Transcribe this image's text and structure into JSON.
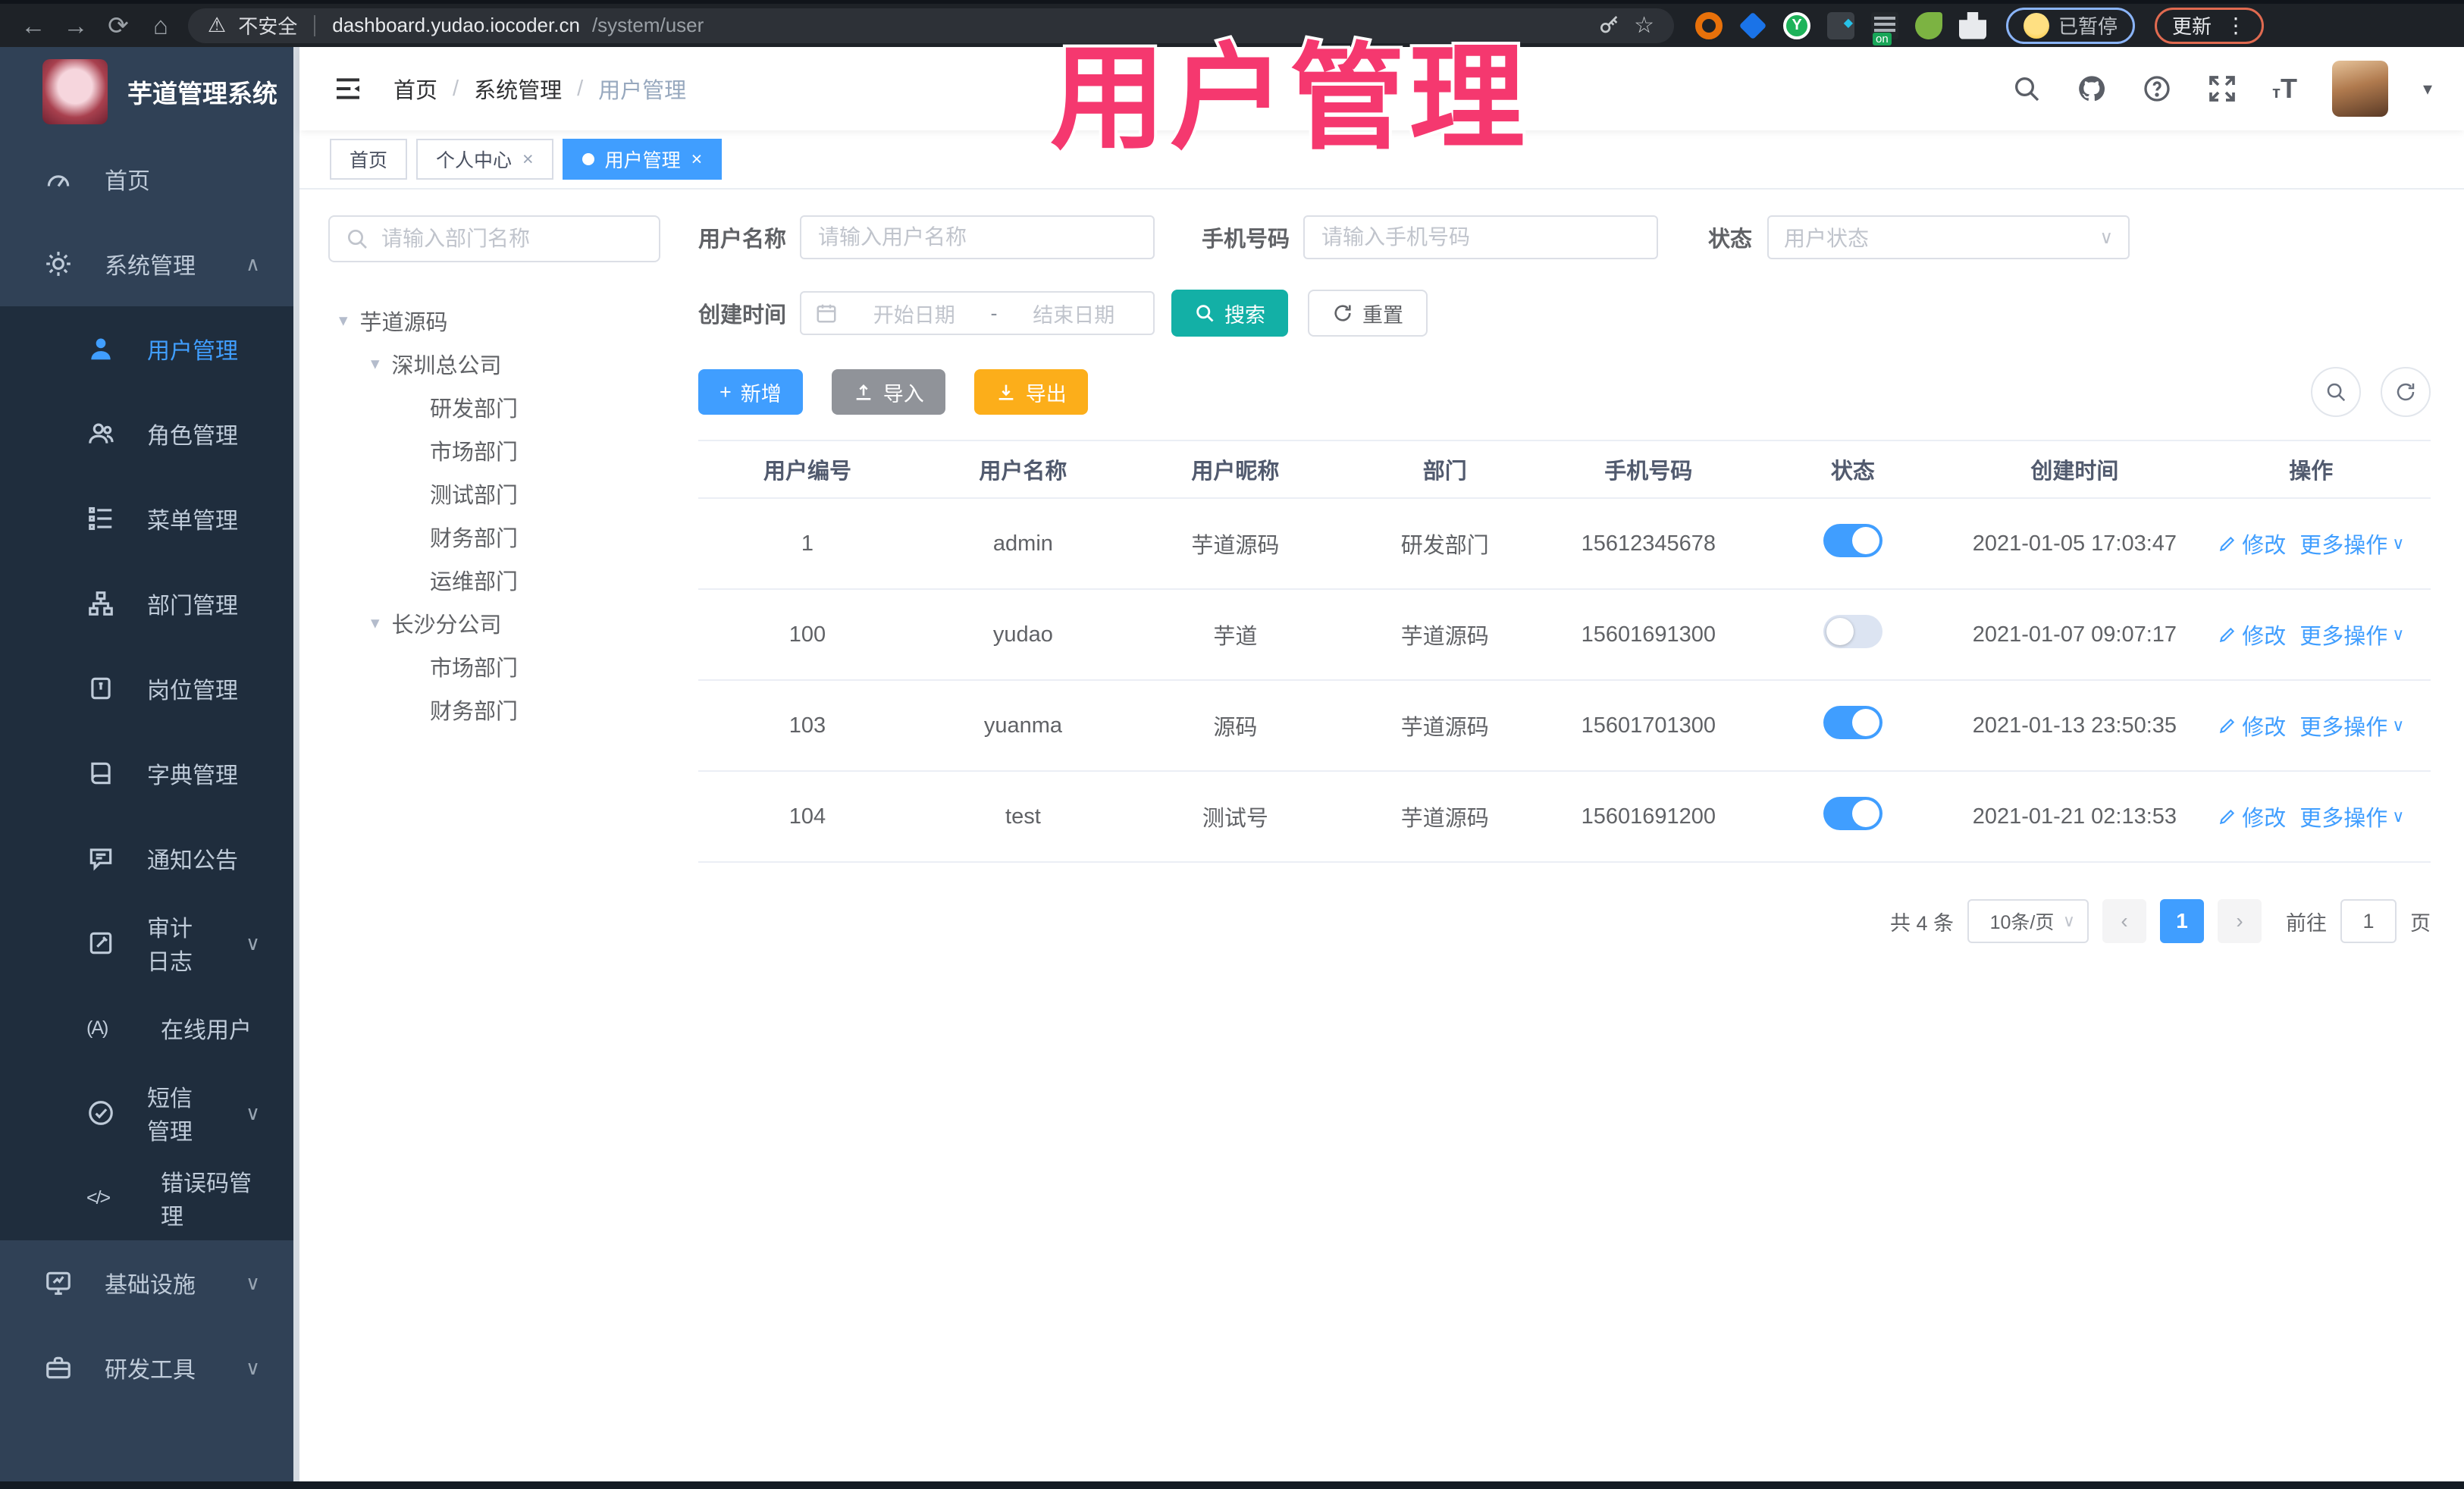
{
  "colors": {
    "accent_blue": "#409eff",
    "search_teal": "#13b0a6",
    "export_amber": "#fcae1a",
    "import_gray": "#909399",
    "sidebar_bg": "#304156",
    "submenu_bg": "#1f2d3d",
    "overlay_pink": "#f5386f",
    "toggle_off": "#dce4f2"
  },
  "browser": {
    "security_label": "不安全",
    "url_host": "dashboard.yudao.iocoder.cn",
    "url_path": "/system/user",
    "paused_label": "已暂停",
    "update_label": "更新",
    "nav_icons": [
      "back-icon",
      "forward-icon",
      "reload-icon",
      "home-icon"
    ],
    "pill_icons": [
      "warning-icon",
      "key-icon",
      "star-icon"
    ],
    "glyphs": {
      "back": "←",
      "forward": "→",
      "reload": "⟳",
      "home": "⌂",
      "warning": "⚠",
      "star": "☆",
      "kebab": "⋮",
      "green_ext": "Y"
    }
  },
  "overlay_title": "用户管理",
  "sidebar": {
    "logo_title": "芋道管理系统",
    "items": [
      {
        "label": "首页",
        "icon": "gauge-icon"
      },
      {
        "label": "系统管理",
        "icon": "gear-icon",
        "chevron": "∧"
      },
      {
        "label": "用户管理",
        "icon": "user-icon",
        "active": true
      },
      {
        "label": "角色管理",
        "icon": "roles-icon"
      },
      {
        "label": "菜单管理",
        "icon": "menu-list-icon"
      },
      {
        "label": "部门管理",
        "icon": "org-tree-icon"
      },
      {
        "label": "岗位管理",
        "icon": "post-badge-icon"
      },
      {
        "label": "字典管理",
        "icon": "dictionary-icon"
      },
      {
        "label": "通知公告",
        "icon": "announcement-icon"
      },
      {
        "label": "审计日志",
        "icon": "audit-log-icon",
        "chevron": "∨"
      },
      {
        "label": "在线用户",
        "icon": "online-user-icon",
        "icon_text": "(A)"
      },
      {
        "label": "短信管理",
        "icon": "sms-icon",
        "chevron": "∨"
      },
      {
        "label": "错误码管理",
        "icon": "error-code-icon",
        "icon_text": "</>"
      },
      {
        "label": "基础设施",
        "icon": "infrastructure-icon",
        "chevron": "∨"
      },
      {
        "label": "研发工具",
        "icon": "dev-tools-icon",
        "chevron": "∨"
      }
    ]
  },
  "topbar": {
    "breadcrumb": [
      "首页",
      "系统管理",
      "用户管理"
    ],
    "separator": "/",
    "icons": [
      "search-icon",
      "github-icon",
      "help-icon",
      "fullscreen-icon",
      "font-size-icon",
      "avatar",
      "caret-down-icon"
    ],
    "caret": "▾"
  },
  "tabs": [
    {
      "label": "首页"
    },
    {
      "label": "个人中心",
      "close": "×"
    },
    {
      "label": "用户管理",
      "close": "×",
      "active": true
    }
  ],
  "dept_panel": {
    "search_placeholder": "请输入部门名称",
    "caret": "▾",
    "tree": [
      {
        "label": "芋道源码"
      },
      {
        "label": "深圳总公司"
      },
      {
        "label": "研发部门"
      },
      {
        "label": "市场部门"
      },
      {
        "label": "测试部门"
      },
      {
        "label": "财务部门"
      },
      {
        "label": "运维部门"
      },
      {
        "label": "长沙分公司"
      },
      {
        "label": "市场部门"
      },
      {
        "label": "财务部门"
      }
    ]
  },
  "filters": {
    "username_label": "用户名称",
    "username_placeholder": "请输入用户名称",
    "mobile_label": "手机号码",
    "mobile_placeholder": "请输入手机号码",
    "status_label": "状态",
    "status_placeholder": "用户状态",
    "create_time_label": "创建时间",
    "date_start_placeholder": "开始日期",
    "date_separator": "-",
    "date_end_placeholder": "结束日期",
    "search_button": "搜索",
    "reset_button": "重置"
  },
  "toolbar": {
    "add_button": "新增",
    "import_button": "导入",
    "export_button": "导出",
    "plus_glyph": "+",
    "circle_icons": [
      "search-icon",
      "refresh-icon"
    ]
  },
  "table": {
    "headers": [
      "用户编号",
      "用户名称",
      "用户昵称",
      "部门",
      "手机号码",
      "状态",
      "创建时间",
      "操作"
    ],
    "actions": {
      "edit": "修改",
      "more": "更多操作",
      "chevron": "∨"
    },
    "rows": [
      {
        "id": "1",
        "username": "admin",
        "nickname": "芋道源码",
        "dept": "研发部门",
        "mobile": "15612345678",
        "toggle_class": "switch on",
        "created": "2021-01-05 17:03:47"
      },
      {
        "id": "100",
        "username": "yudao",
        "nickname": "芋道",
        "dept": "芋道源码",
        "mobile": "15601691300",
        "toggle_class": "switch off",
        "created": "2021-01-07 09:07:17"
      },
      {
        "id": "103",
        "username": "yuanma",
        "nickname": "源码",
        "dept": "芋道源码",
        "mobile": "15601701300",
        "toggle_class": "switch on",
        "created": "2021-01-13 23:50:35"
      },
      {
        "id": "104",
        "username": "test",
        "nickname": "测试号",
        "dept": "芋道源码",
        "mobile": "15601691200",
        "toggle_class": "switch on",
        "created": "2021-01-21 02:13:53"
      }
    ]
  },
  "pagination": {
    "total_text": "共 4 条",
    "page_size": "10条/页",
    "prev": "‹",
    "current_page": "1",
    "next": "›",
    "goto_label": "前往",
    "goto_value": "1",
    "page_unit": "页"
  }
}
